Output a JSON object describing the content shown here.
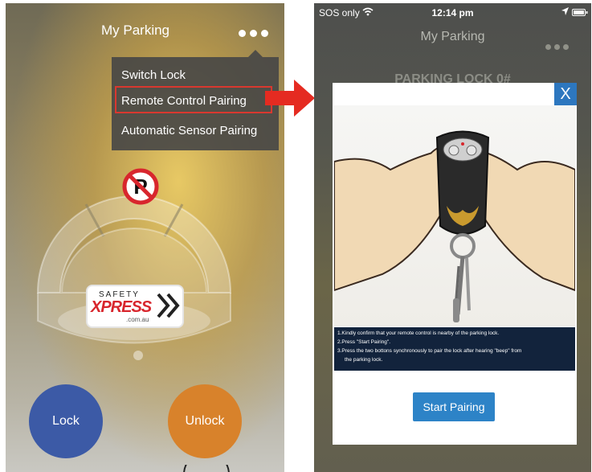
{
  "left_screen": {
    "title": "My Parking",
    "menu": {
      "items": [
        "Switch Lock",
        "Remote Control Pairing",
        "Automatic Sensor Pairing"
      ],
      "highlighted_index": 1
    },
    "logo": {
      "line1": "SAFETY",
      "line2": "XPRESS",
      "line3": ".com.au"
    },
    "buttons": {
      "lock": "Lock",
      "unlock": "Unlock"
    }
  },
  "right_screen": {
    "status_bar": {
      "carrier": "SOS only",
      "time": "12:14 pm"
    },
    "title": "My Parking",
    "heading": "PARKING LOCK 0#",
    "modal": {
      "close_label": "X",
      "instructions": [
        "1.Kindly confirm that your remote control is nearby of the parking lock.",
        "2.Press \"Start Pairing\".",
        "3.Press the two bottons synchronously to pair the lock after hearing \"beep\" from",
        "the parking lock."
      ],
      "start_button": "Start Pairing"
    }
  },
  "colors": {
    "lock_button": "#3c5aa6",
    "unlock_button": "#d8822b",
    "highlight_border": "#d9382f",
    "arrow": "#e52b21",
    "modal_button": "#2d83c7",
    "instruction_bg": "#12233c"
  },
  "icons": [
    "more-dots-icon",
    "no-parking-icon",
    "arrow-right-icon",
    "wifi-icon",
    "location-icon",
    "battery-icon",
    "close-icon"
  ]
}
